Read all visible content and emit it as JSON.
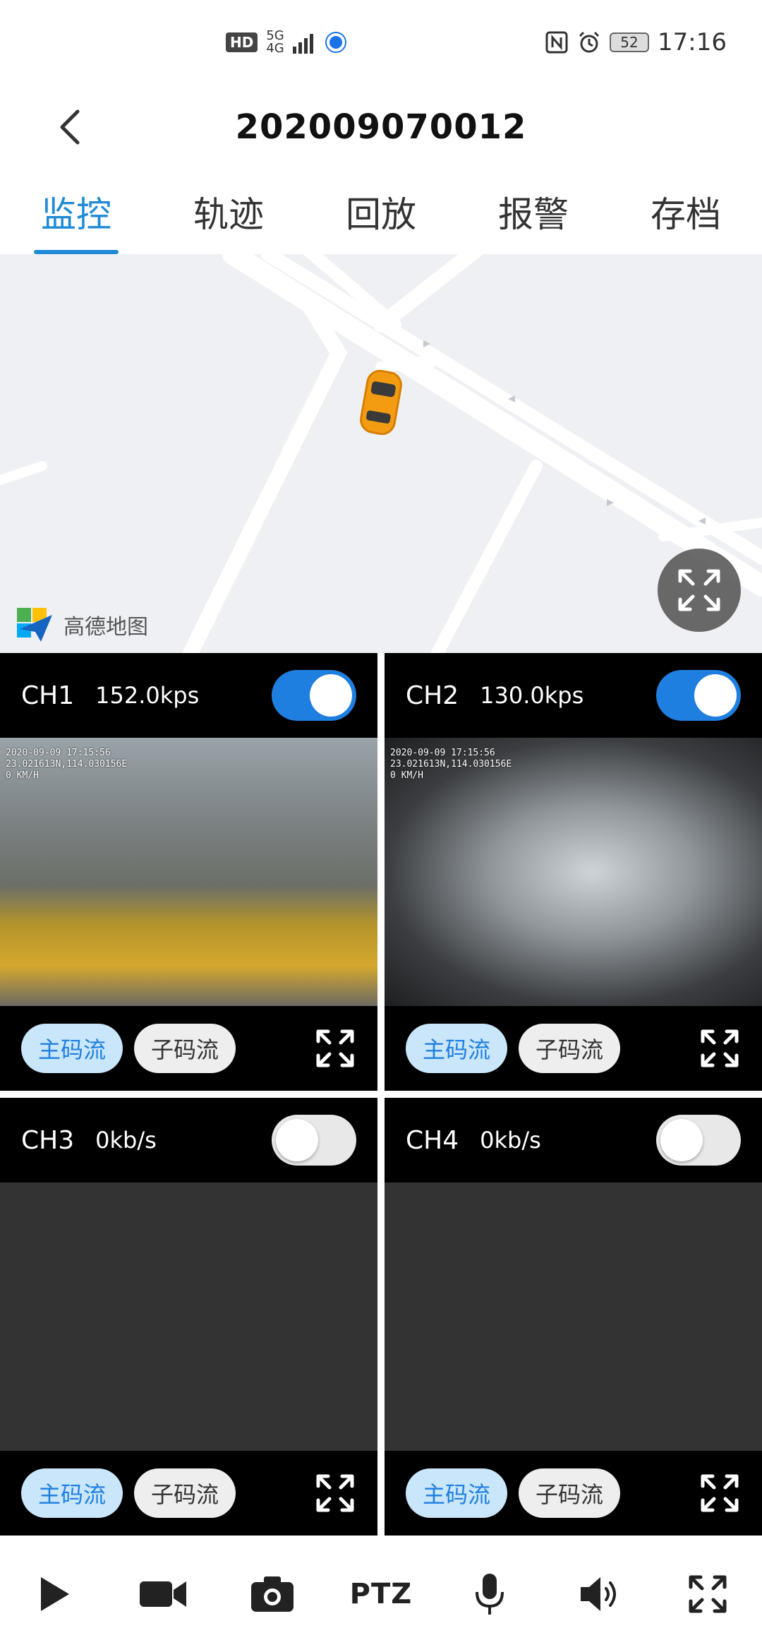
{
  "status_bar": {
    "hd": "HD",
    "network_top": "5G",
    "network_bottom": "4G",
    "battery": "52",
    "time": "17:16"
  },
  "header": {
    "title": "202009070012"
  },
  "tabs": [
    {
      "label": "监控",
      "active": true
    },
    {
      "label": "轨迹",
      "active": false
    },
    {
      "label": "回放",
      "active": false
    },
    {
      "label": "报警",
      "active": false
    },
    {
      "label": "存档",
      "active": false
    }
  ],
  "map": {
    "provider": "高德地图",
    "vehicle_color": "#f39c12"
  },
  "channels": [
    {
      "name": "CH1",
      "rate": "152.0kps",
      "enabled": true,
      "osd_date": "2020-09-09 17:15:56",
      "osd_coord": "23.021613N,114.030156E",
      "osd_speed": "0 KM/H",
      "main_stream": "主码流",
      "sub_stream": "子码流"
    },
    {
      "name": "CH2",
      "rate": "130.0kps",
      "enabled": true,
      "osd_date": "2020-09-09 17:15:56",
      "osd_coord": "23.021613N,114.030156E",
      "osd_speed": "0 KM/H",
      "main_stream": "主码流",
      "sub_stream": "子码流"
    },
    {
      "name": "CH3",
      "rate": "0kb/s",
      "enabled": false,
      "main_stream": "主码流",
      "sub_stream": "子码流"
    },
    {
      "name": "CH4",
      "rate": "0kb/s",
      "enabled": false,
      "main_stream": "主码流",
      "sub_stream": "子码流"
    }
  ],
  "toolbar": {
    "items": [
      "play-icon",
      "video-camera-icon",
      "camera-icon",
      "PTZ",
      "microphone-icon",
      "speaker-icon",
      "fullscreen-icon"
    ],
    "ptz_label": "PTZ"
  },
  "colors": {
    "accent": "#1f8ad6",
    "toggle_on": "#1f7fe0",
    "pill_main_bg": "#c9e6fb",
    "panel_bg": "#000000"
  }
}
